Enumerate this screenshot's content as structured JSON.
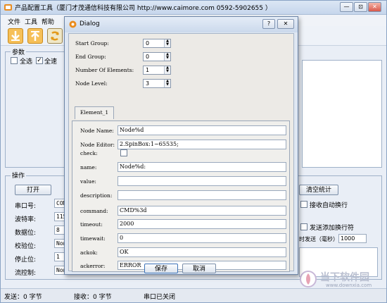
{
  "app": {
    "title": "产品配置工具（厦门才茂通信科技有限公司 http://www.caimore.com  0592-5902655 ）",
    "window_buttons": [
      "—",
      "⊡",
      "✕"
    ]
  },
  "menu": [
    "文件",
    "工具",
    "帮助"
  ],
  "params_group": {
    "label": "参数",
    "select_all": "全选",
    "all_fast": "全速"
  },
  "ops_group": {
    "label": "操作",
    "open_button": "打开",
    "clear_stats_button": "清空统计",
    "fields": [
      {
        "label": "串口号:",
        "value": "COM"
      },
      {
        "label": "波特率:",
        "value": "115"
      },
      {
        "label": "数据位:",
        "value": "8"
      },
      {
        "label": "校验位:",
        "value": "Non"
      },
      {
        "label": "停止位:",
        "value": "1"
      },
      {
        "label": "流控制:",
        "value": "Non"
      }
    ],
    "recv_auto_newline": "接收自动换行",
    "send_add_newline": "发送添加换行符",
    "timed_send_label": "时发送（毫秒）",
    "timed_send_value": "1000"
  },
  "statusbar": {
    "sent": "发送：0 字节",
    "received": "接收：0 字节",
    "port_status": "串口已关闭"
  },
  "dialog": {
    "title": "Dialog",
    "help_btn": "?",
    "close_btn": "✕",
    "spins": [
      {
        "label": "Start Group:",
        "value": "0"
      },
      {
        "label": "End Group:",
        "value": "0"
      },
      {
        "label": "Number Of Elements:",
        "value": "1"
      },
      {
        "label": "Node Level:",
        "value": "3"
      }
    ],
    "tab_label": "Element_1",
    "fields": [
      {
        "label": "Node Name:",
        "value": "Node%d"
      },
      {
        "label": "Node Editor:",
        "value": "2.SpinBox:1~65535;"
      },
      {
        "label": "check:",
        "value": ""
      },
      {
        "label": "name:",
        "value": "Node%d:"
      },
      {
        "label": "value:",
        "value": ""
      },
      {
        "label": "description:",
        "value": ""
      },
      {
        "label": "command:",
        "value": "CMD%3d"
      },
      {
        "label": "timeout:",
        "value": "2000"
      },
      {
        "label": "timewait:",
        "value": "0"
      },
      {
        "label": "ackok:",
        "value": "OK"
      },
      {
        "label": "ackerror:",
        "value": "ERROR"
      }
    ],
    "save_button": "保存",
    "cancel_button": "取消"
  },
  "watermark": {
    "brand": "当下软件园",
    "url": "www.downxia.com"
  },
  "colors": {
    "accent": "#6c84a6",
    "toolbar_orange": "#f0a020"
  }
}
